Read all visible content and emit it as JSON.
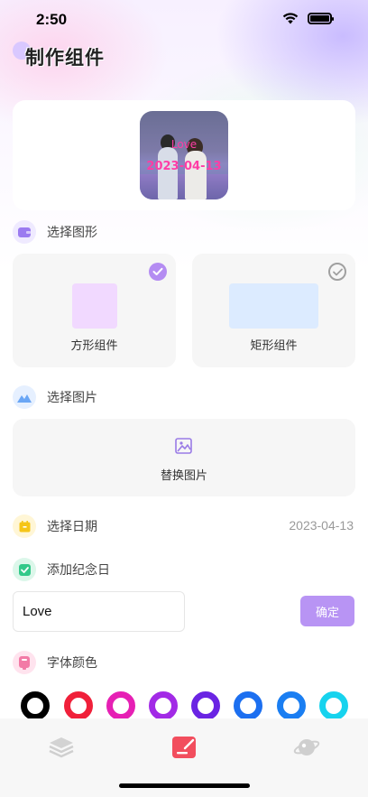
{
  "status_bar": {
    "time": "2:50"
  },
  "page": {
    "title": "制作组件"
  },
  "preview": {
    "overlay_title": "Love",
    "overlay_date": "2023-04-13"
  },
  "sections": {
    "shape": {
      "label": "选择图形",
      "icon": "wallet-icon",
      "color": "#9b7bf0"
    },
    "image": {
      "label": "选择图片",
      "icon": "mountain-image-icon",
      "color": "#6aa6f5"
    },
    "date": {
      "label": "选择日期",
      "icon": "calendar-icon",
      "color": "#f5c518",
      "value": "2023-04-13"
    },
    "anniversary": {
      "label": "添加纪念日",
      "icon": "check-square-icon",
      "color": "#33c98a"
    },
    "font_color": {
      "label": "字体颜色",
      "icon": "palette-icon",
      "color": "#f27aa6"
    }
  },
  "shapes": [
    {
      "label": "方形组件",
      "selected": true,
      "fill": "#f1d9ff"
    },
    {
      "label": "矩形组件",
      "selected": false,
      "fill": "#dcebff"
    }
  ],
  "image_card": {
    "label": "替换图片",
    "icon": "replace-image-icon"
  },
  "anniversary_input": {
    "value": "Love",
    "confirm_label": "确定"
  },
  "font_colors": [
    "#000000",
    "#f0203a",
    "#e620b4",
    "#a22ae6",
    "#6a24e3",
    "#1c6ff0",
    "#1a7ef2",
    "#17d3ee"
  ],
  "tabbar": {
    "tabs": [
      {
        "name": "layers-icon",
        "active": false
      },
      {
        "name": "edit-widget-icon",
        "active": true
      },
      {
        "name": "planet-icon",
        "active": false
      }
    ]
  }
}
